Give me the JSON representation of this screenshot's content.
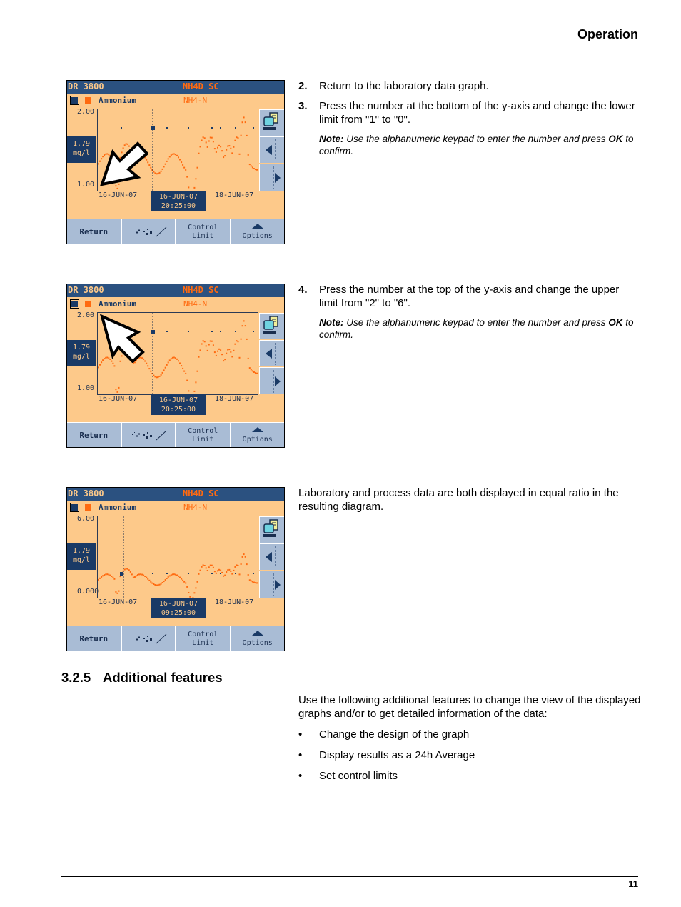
{
  "header": {
    "title": "Operation"
  },
  "footer": {
    "page_number": "11"
  },
  "screens": [
    {
      "model": "DR 3800",
      "sensor": "NH4D SC",
      "parameter": "Ammonium",
      "parameter_form": "NH4-N",
      "y_max": "2.00",
      "y_min": "1.00",
      "current_value": "1.79",
      "current_unit": "mg/l",
      "x_left": "16-JUN-07",
      "x_right": "18-JUN-07",
      "cursor_date": "16-JUN-07",
      "cursor_time": "20:25:00",
      "cursor_pointing_at": "y-axis minimum",
      "buttons": {
        "return": "Return",
        "control_1": "Control",
        "control_2": "Limit",
        "options": "Options"
      }
    },
    {
      "model": "DR 3800",
      "sensor": "NH4D SC",
      "parameter": "Ammonium",
      "parameter_form": "NH4-N",
      "y_max": "2.00",
      "y_min": "1.00",
      "current_value": "1.79",
      "current_unit": "mg/l",
      "x_left": "16-JUN-07",
      "x_right": "18-JUN-07",
      "cursor_date": "16-JUN-07",
      "cursor_time": "20:25:00",
      "cursor_pointing_at": "y-axis maximum",
      "buttons": {
        "return": "Return",
        "control_1": "Control",
        "control_2": "Limit",
        "options": "Options"
      }
    },
    {
      "model": "DR 3800",
      "sensor": "NH4D SC",
      "parameter": "Ammonium",
      "parameter_form": "NH4-N",
      "y_max": "6.00",
      "y_min": "0.000",
      "current_value": "1.79",
      "current_unit": "mg/l",
      "x_left": "16-JUN-07",
      "x_right": "18-JUN-07",
      "cursor_date": "16-JUN-07",
      "cursor_time": "09:25:00",
      "buttons": {
        "return": "Return",
        "control_1": "Control",
        "control_2": "Limit",
        "options": "Options"
      }
    }
  ],
  "steps": [
    {
      "number": "2.",
      "text": "Return to the laboratory data graph."
    },
    {
      "number": "3.",
      "text": "Press the number at the bottom of the y-axis and change the lower limit from \"1\" to \"0\"."
    },
    {
      "number": "4.",
      "text": "Press the number at the top of the y-axis and change the upper limit from \"2\" to \"6\"."
    }
  ],
  "notes": [
    {
      "label": "Note:",
      "text_before": "Use the alphanumeric keypad to enter the number and press",
      "ok": "OK",
      "text_after": "to confirm."
    },
    {
      "label": "Note:",
      "text_before": "Use the alphanumeric keypad to enter the number and press",
      "ok": "OK",
      "text_after": "to confirm."
    }
  ],
  "result_paragraph": "Laboratory and process data are both displayed in equal ratio in the resulting diagram.",
  "section": {
    "number": "3.2.5",
    "title": "Additional features",
    "intro": "Use the following additional features to change the view of the displayed graphs and/or to get detailed information of the data:",
    "bullet_glyph": "•",
    "bullets": [
      "Change the design of the graph",
      "Display results as a 24h Average",
      "Set control limits"
    ]
  },
  "colors": {
    "title_bar": "#2b5180",
    "screen_bg": "#fdc98a",
    "process_data": "#ff6a10",
    "lab_data": "#1a3a66",
    "button_bg": "#a9bcd5"
  }
}
